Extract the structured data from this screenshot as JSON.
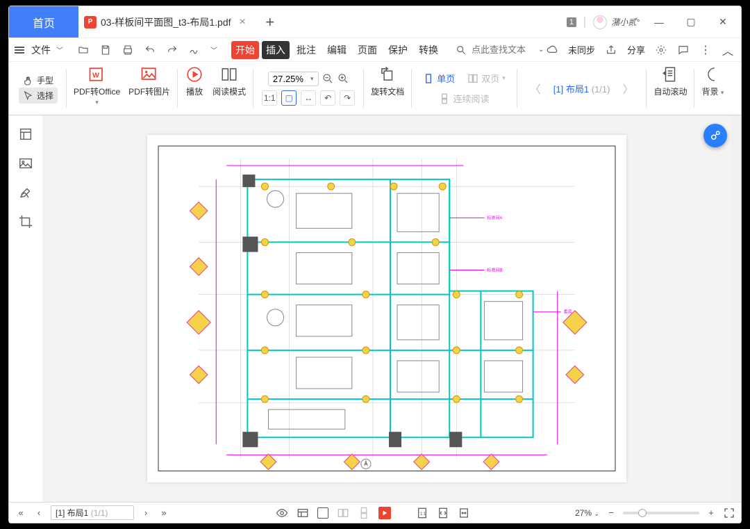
{
  "titlebar": {
    "home": "首页",
    "doc_name": "03-样板间平面图_t3-布局1.pdf",
    "badge": "1",
    "signature": "潴小贰°"
  },
  "menubar": {
    "file": "文件",
    "tabs": {
      "start": "开始",
      "insert": "插入",
      "annot": "批注",
      "edit": "编辑",
      "page": "页面",
      "protect": "保护",
      "convert": "转换"
    },
    "search_placeholder": "点此查找文本",
    "unsync": "未同步",
    "share": "分享"
  },
  "ribbon": {
    "hand": "手型",
    "select": "选择",
    "pdf_office": "PDF转Office",
    "pdf_image": "PDF转图片",
    "play": "播放",
    "read_mode": "阅读模式",
    "zoom": "27.25%",
    "rotate_doc": "旋转文档",
    "single_page": "单页",
    "double_page": "双页",
    "continuous": "连续阅读",
    "auto_scroll": "自动滚动",
    "background": "背景",
    "page_label": "[1] 布局1",
    "page_count": "(1/1)"
  },
  "status": {
    "page_label": "[1] 布局1",
    "page_count": "(1/1)",
    "zoom": "27%"
  }
}
